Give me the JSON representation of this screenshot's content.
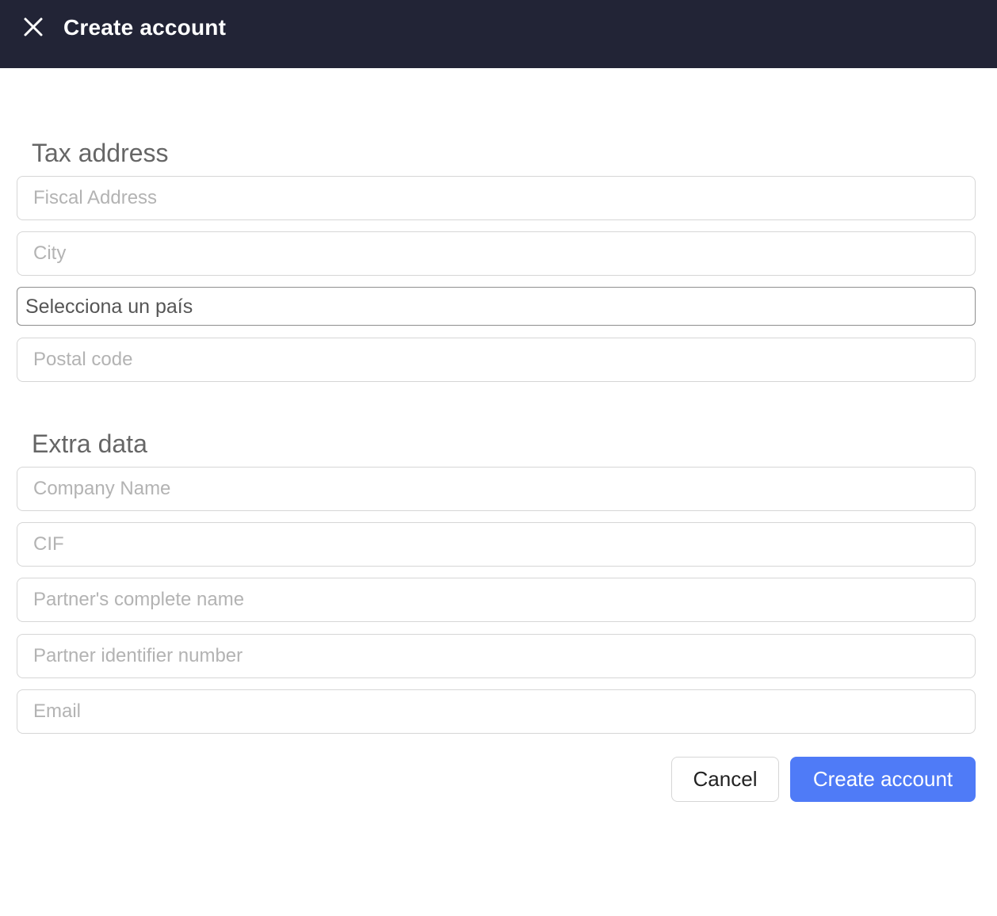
{
  "header": {
    "title": "Create account",
    "close_icon": "close-icon",
    "background_color": "#222436"
  },
  "tax_address": {
    "title": "Tax address",
    "fiscal_address_placeholder": "Fiscal Address",
    "city_placeholder": "City",
    "country_select_value": "Selecciona un país",
    "postal_code_placeholder": "Postal code"
  },
  "extra_data": {
    "title": "Extra data",
    "company_name_placeholder": "Company Name",
    "cif_placeholder": "CIF",
    "partner_name_placeholder": "Partner's complete name",
    "partner_id_placeholder": "Partner identifier number",
    "email_placeholder": "Email"
  },
  "actions": {
    "cancel_label": "Cancel",
    "create_label": "Create account",
    "accent_color": "#4f7bf7"
  }
}
